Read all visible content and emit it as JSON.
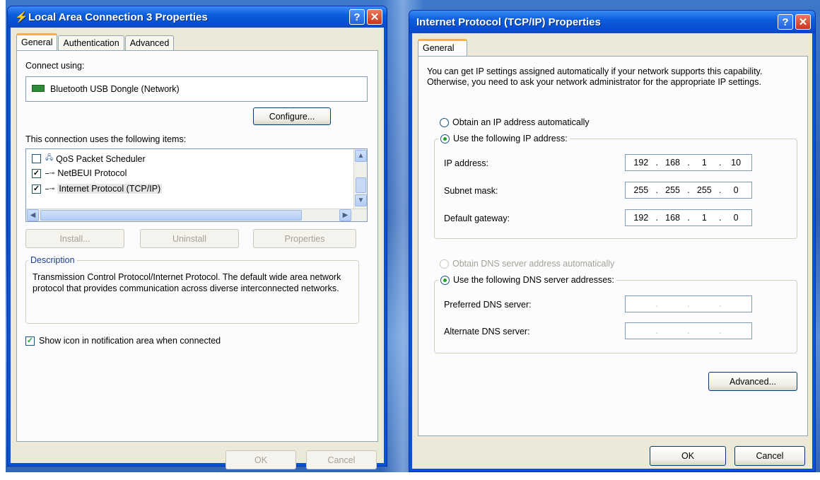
{
  "left_window": {
    "title": "Local Area Connection 3 Properties",
    "help_label": "?",
    "close_label": "✕",
    "tabs": [
      "General",
      "Authentication",
      "Advanced"
    ],
    "connect_using_label": "Connect using:",
    "adapter_name": "Bluetooth USB Dongle (Network)",
    "configure_label": "Configure...",
    "items_label": "This connection uses the following items:",
    "items": [
      {
        "label": "QoS Packet Scheduler",
        "checked": false
      },
      {
        "label": "NetBEUI Protocol",
        "checked": true
      },
      {
        "label": "Internet Protocol (TCP/IP)",
        "checked": true
      }
    ],
    "install_label": "Install...",
    "uninstall_label": "Uninstall",
    "properties_label": "Properties",
    "description_title": "Description",
    "description_text": "Transmission Control Protocol/Internet Protocol. The default wide area network protocol that provides communication across diverse interconnected networks.",
    "show_icon_label": "Show icon in notification area when connected",
    "ok_label": "OK",
    "cancel_label": "Cancel"
  },
  "right_window": {
    "title": "Internet Protocol (TCP/IP) Properties",
    "help_label": "?",
    "close_label": "✕",
    "tab": "General",
    "intro_text": "You can get IP settings assigned automatically if your network supports this capability. Otherwise, you need to ask your network administrator for the appropriate IP settings.",
    "obtain_ip_label": "Obtain an IP address automatically",
    "use_ip_label": "Use the following IP address:",
    "ip_address_label": "IP address:",
    "ip_address": [
      "192",
      "168",
      "1",
      "10"
    ],
    "subnet_label": "Subnet mask:",
    "subnet": [
      "255",
      "255",
      "255",
      "0"
    ],
    "gateway_label": "Default gateway:",
    "gateway": [
      "192",
      "168",
      "1",
      "0"
    ],
    "obtain_dns_label": "Obtain DNS server address automatically",
    "use_dns_label": "Use the following DNS server addresses:",
    "preferred_dns_label": "Preferred DNS server:",
    "alternate_dns_label": "Alternate DNS server:",
    "advanced_label": "Advanced...",
    "ok_label": "OK",
    "cancel_label": "Cancel"
  }
}
